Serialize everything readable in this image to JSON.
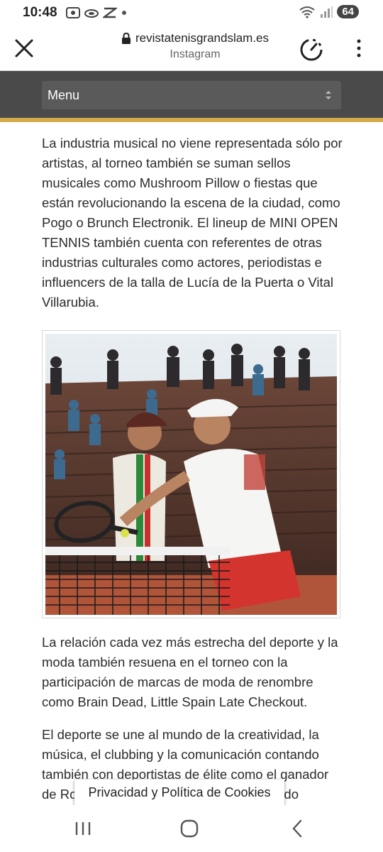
{
  "status_bar": {
    "time": "10:48",
    "battery": "64",
    "icons": [
      "screen-record-icon",
      "cloud-icon",
      "app-icon",
      "dot-icon",
      "wifi-icon",
      "signal-icon"
    ]
  },
  "browser": {
    "url": "revistatenisgrandslam.es",
    "subtitle": "Instagram",
    "icons": [
      "close-icon",
      "lock-icon",
      "timer-icon",
      "more-vertical-icon"
    ]
  },
  "menu": {
    "label": "Menu"
  },
  "article": {
    "paragraph1": "La industria musical no viene representada sólo por artistas, al torneo también se suman sellos musicales como Mushroom Pillow o fiestas que están revolucionando la escena de la ciudad, como Pogo o Brunch Electronik. El lineup de MINI OPEN TENNIS también cuenta con referentes de otras industrias culturales como actores, periodistas e influencers de la talla de Lucía de la Puerta o Vital Villarubia.",
    "paragraph2": "La relación cada vez más estrecha del deporte y la moda también resuena en el torneo con la participación de marcas de moda de renombre como Brain Dead, Little Spain Late Checkout.",
    "paragraph3": "El deporte se une al mundo de la creatividad, la música, el clubbing y la comunicación contando también con deportistas de élite como el ganador de Roland Garros, Albert Costa, o Fernando"
  },
  "cookie": {
    "label": "Privacidad y Política de Cookies"
  },
  "colors": {
    "menu_bg": "#4a4a4a",
    "menu_accent": "#d4aa4a",
    "text": "#2b2b2b"
  }
}
